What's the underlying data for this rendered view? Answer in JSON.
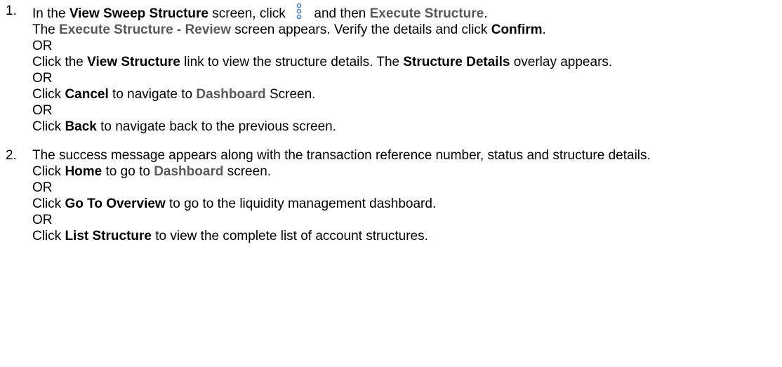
{
  "steps": [
    {
      "number": "1.",
      "line1": {
        "p1": "In the ",
        "screen": "View Sweep Structure",
        "p2": " screen, click ",
        "icon": "kebab-menu-icon",
        "p3": " and then ",
        "action": "Execute Structure",
        "p4": "."
      },
      "line2": {
        "p1": "The ",
        "screen": "Execute Structure - Review",
        "p2": " screen appears. Verify the details and click ",
        "button": "Confirm",
        "p3": "."
      },
      "or1": "OR",
      "line3": {
        "p1": "Click the ",
        "link": "View Structure",
        "p2": " link to view the structure details. The ",
        "overlay": "Structure Details",
        "p3": " overlay appears."
      },
      "or2": "OR",
      "line4": {
        "p1": "Click ",
        "button": "Cancel",
        "p2": " to navigate to ",
        "screen": "Dashboard",
        "p3": " Screen."
      },
      "or3": "OR",
      "line5": {
        "p1": "Click ",
        "button": "Back",
        "p2": " to navigate back to the previous screen."
      }
    },
    {
      "number": "2.",
      "line1": "The success message appears along with the transaction reference number, status and structure details.",
      "line2": {
        "p1": "Click ",
        "button": "Home",
        "p2": " to go to ",
        "screen": "Dashboard",
        "p3": " screen."
      },
      "or1": "OR",
      "line3": {
        "p1": "Click ",
        "button": "Go To Overview",
        "p2": " to go to the liquidity management dashboard."
      },
      "or2": "OR",
      "line4": {
        "p1": "Click ",
        "button": "List Structure",
        "p2": " to view the complete list of account structures."
      }
    }
  ],
  "colors": {
    "text": "#000000",
    "ui_label": "#595959",
    "icon": "#4a86c5"
  }
}
